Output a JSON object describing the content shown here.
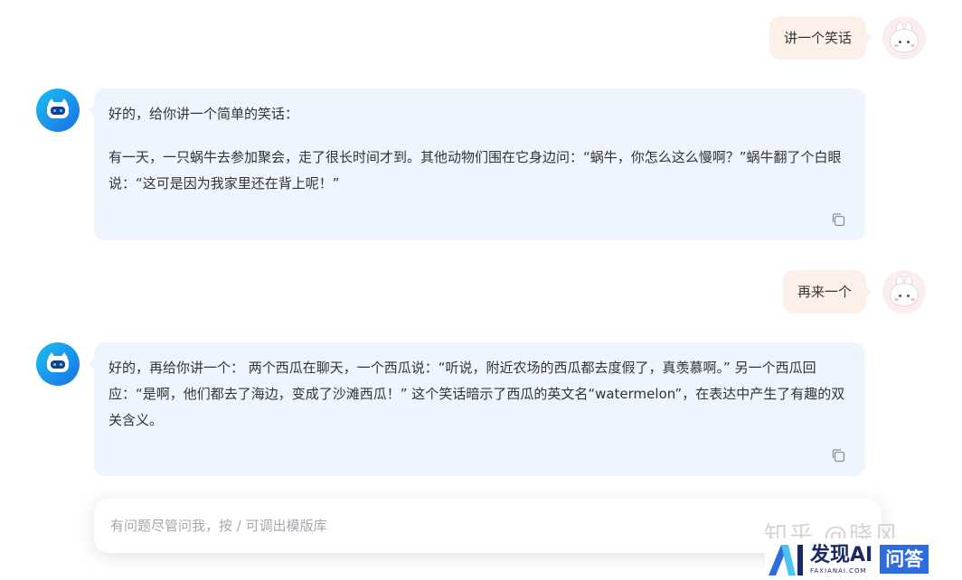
{
  "conversation": {
    "user_1": "讲一个笑话",
    "bot_1": {
      "intro": "好的，给你讲一个简单的笑话：",
      "body": "有一天，一只蜗牛去参加聚会，走了很长时间才到。其他动物们围在它身边问：“蜗牛，你怎么这么慢啊？”蜗牛翻了个白眼说：“这可是因为我家里还在背上呢！”"
    },
    "user_2": "再来一个",
    "bot_2": {
      "body": "好的，再给你讲一个： 两个西瓜在聊天，一个西瓜说：“听说，附近农场的西瓜都去度假了，真羡慕啊。” 另一个西瓜回应：“是啊，他们都去了海边，变成了沙滩西瓜！” 这个笑话暗示了西瓜的英文名“watermelon”，在表达中产生了有趣的双关含义。"
    }
  },
  "input": {
    "placeholder": "有问题尽管问我，按 / 可调出模版库"
  },
  "watermark": {
    "zhihu": "知乎 @晓风",
    "brand": "发现AI",
    "brand_sub": "FAXIANAI.COM",
    "badge": "问答"
  },
  "colors": {
    "user_bubble": "#fdf0e8",
    "bot_bubble": "#eef5fe",
    "accent": "#1b6fe8"
  },
  "icons": {
    "user_avatar": "bunny-avatar-icon",
    "bot_avatar": "robot-avatar-icon",
    "copy": "copy-icon"
  }
}
